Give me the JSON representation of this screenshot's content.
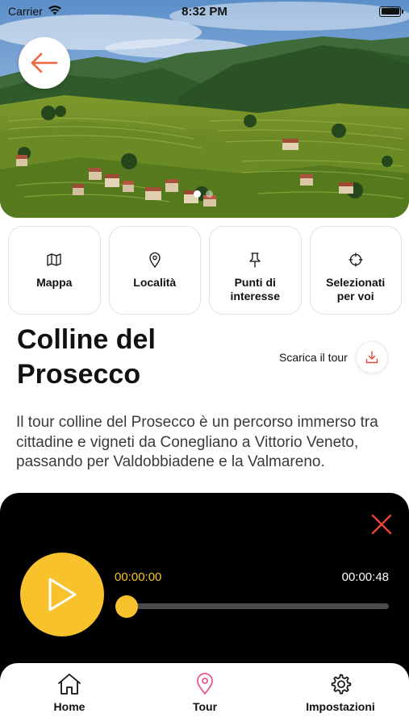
{
  "status_bar": {
    "carrier": "Carrier",
    "time": "8:32 PM"
  },
  "hero": {
    "slide_count": 2,
    "active_slide": 0
  },
  "tiles": [
    {
      "label": "Mappa",
      "icon": "map-icon"
    },
    {
      "label": "Località",
      "icon": "location-pin-icon"
    },
    {
      "label": "Punti di\ninteresse",
      "icon": "pushpin-icon"
    },
    {
      "label": "Selezionati\nper voi",
      "icon": "crosshair-icon"
    }
  ],
  "tour": {
    "title": "Colline del Prosecco",
    "download_label": "Scarica il tour",
    "description": "Il tour colline del Prosecco è un percorso immerso tra cittadine e vigneti da Conegliano a Vittorio Veneto, passando per Valdobbiadene e la Valmareno."
  },
  "player": {
    "current_time": "00:00:00",
    "total_time": "00:00:48",
    "progress": 0
  },
  "tabbar": {
    "tabs": [
      {
        "label": "Home",
        "icon": "home-icon",
        "active": false
      },
      {
        "label": "Tour",
        "icon": "location-pin-icon",
        "active": true
      },
      {
        "label": "Impostazioni",
        "icon": "gear-icon",
        "active": false
      }
    ]
  },
  "colors": {
    "accent": "#f7c22c",
    "back_arrow": "#f0643f",
    "close_x": "#e8453c",
    "tour_icon": "#e8578f",
    "download_icon": "#e8453c"
  }
}
